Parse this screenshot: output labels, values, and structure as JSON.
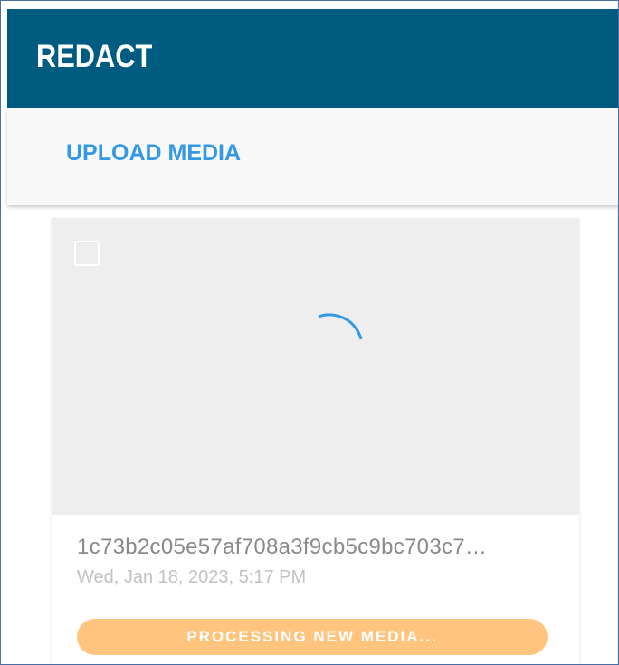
{
  "app": {
    "title": "REDACT"
  },
  "tabs": {
    "upload_label": "UPLOAD MEDIA"
  },
  "media_card": {
    "file_name": "1c73b2c05e57af708a3f9cb5c9bc703c7…",
    "date": "Wed, Jan 18, 2023, 5:17 PM",
    "status": "PROCESSING NEW MEDIA..."
  },
  "colors": {
    "app_bar": "#005b80",
    "tab_accent": "#3399e6",
    "status_pill": "#ffc57e",
    "spinner": "#3399e6"
  },
  "icons": {
    "spinner": "loading-spinner-icon",
    "select": "checkbox-icon"
  }
}
